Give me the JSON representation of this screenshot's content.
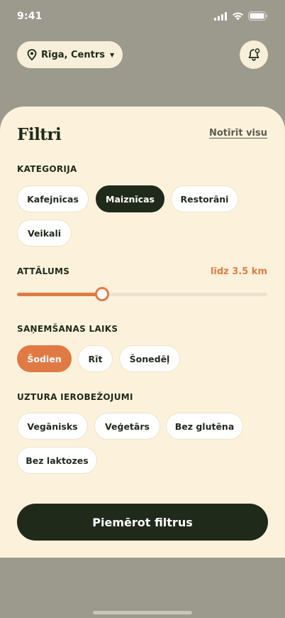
{
  "status_bar": {
    "time": "9:41"
  },
  "header": {
    "location": "Rīga, Centrs"
  },
  "filters": {
    "title": "Filtri",
    "clear_label": "Notīrīt visu",
    "category": {
      "label": "KATEGORIJA",
      "options": [
        "Kafejnīcas",
        "Maiznīcas",
        "Restorāni",
        "Veikali"
      ],
      "selected": "Maiznīcas"
    },
    "distance": {
      "label": "ATTĀLUMS",
      "value_text": "līdz 3.5 km",
      "fraction": 0.34
    },
    "pickup": {
      "label": "SAŅEMŠANAS LAIKS",
      "options": [
        "Šodien",
        "Rīt",
        "Šonedēļ"
      ],
      "selected": "Šodien"
    },
    "diet": {
      "label": "UZTURA IEROBEŽOJUMI",
      "options": [
        "Vegānisks",
        "Veģetārs",
        "Bez glutēna",
        "Bez laktozes"
      ]
    },
    "apply_label": "Piemērot filtrus"
  },
  "colors": {
    "accent_orange": "#e07a45",
    "dark_green": "#1f2a1b",
    "sheet_bg": "#fcf2dc",
    "backdrop": "#9c9a8c"
  }
}
